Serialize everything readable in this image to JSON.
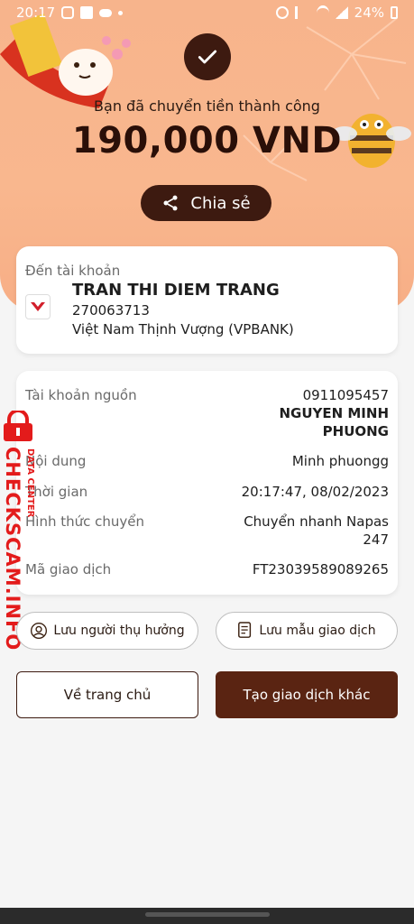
{
  "status": {
    "time": "20:17",
    "battery": "24%"
  },
  "hero": {
    "success_text": "Bạn đã chuyển tiền thành công",
    "amount": "190,000 VND",
    "share_label": "Chia sẻ"
  },
  "recipient": {
    "label": "Đến tài khoản",
    "name": "TRAN THI DIEM TRANG",
    "account": "270063713",
    "bank": "Việt Nam Thịnh Vượng (VPBANK)"
  },
  "details": {
    "source_label": "Tài khoản nguồn",
    "source_account": "0911095457",
    "source_name_1": "NGUYEN MINH",
    "source_name_2": "PHUONG",
    "content_label": "Nội dung",
    "content_value": "Minh phuongg",
    "time_label": "Thời gian",
    "time_value": "20:17:47, 08/02/2023",
    "method_label": "Hình thức chuyển",
    "method_value_1": "Chuyển nhanh Napas",
    "method_value_2": "247",
    "txid_label": "Mã giao dịch",
    "txid_value": "FT23039589089265"
  },
  "actions": {
    "save_beneficiary": "Lưu người thụ hưởng",
    "save_template": "Lưu mẫu giao dịch",
    "home": "Về trang chủ",
    "new_transaction": "Tạo giao dịch khác"
  },
  "watermark": {
    "main": "CHECKSCAM.INFO",
    "sub": "DATA CENTER"
  },
  "colors": {
    "accent": "#3d1a10",
    "hero": "#f7b48c",
    "button_dark": "#5a2412",
    "watermark": "#e31b1b"
  }
}
